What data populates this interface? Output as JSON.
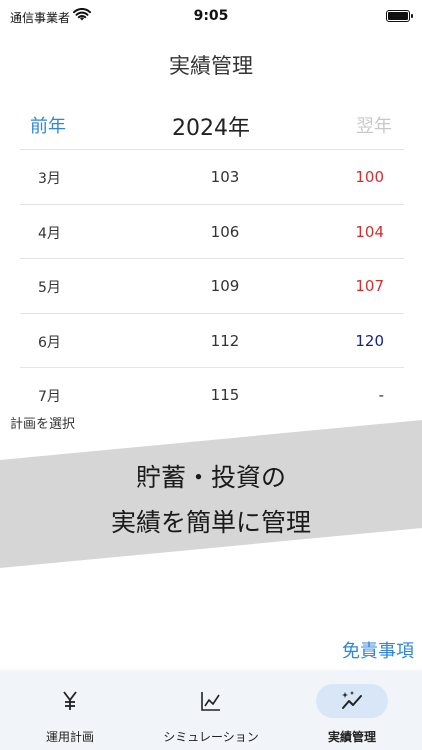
{
  "status_bar": {
    "carrier": "通信事業者",
    "time": "9:05"
  },
  "page": {
    "title": "実績管理"
  },
  "year_nav": {
    "prev": "前年",
    "current": "2024年",
    "next": "翌年"
  },
  "rows": [
    {
      "month": "3月",
      "actual": "103",
      "plan": "100",
      "plan_color": "#d32f2f"
    },
    {
      "month": "4月",
      "actual": "106",
      "plan": "104",
      "plan_color": "#d32f2f"
    },
    {
      "month": "5月",
      "actual": "109",
      "plan": "107",
      "plan_color": "#d32f2f"
    },
    {
      "month": "6月",
      "actual": "112",
      "plan": "120",
      "plan_color": "#1a237e"
    },
    {
      "month": "7月",
      "actual": "115",
      "plan": "-",
      "plan_color": "#333333"
    }
  ],
  "plan_select_label": "計画を選択",
  "banner": {
    "line1": "貯蓄・投資の",
    "line2": "実績を簡単に管理"
  },
  "disclaimer_link": "免責事項",
  "tabs": [
    {
      "label": "運用計画",
      "icon": "yen-icon",
      "active": false
    },
    {
      "label": "シミュレーション",
      "icon": "chart-icon",
      "active": false
    },
    {
      "label": "実績管理",
      "icon": "sparkle-chart-icon",
      "active": true
    }
  ],
  "colors": {
    "accent": "#2f86dc",
    "over_plan": "#d32f2f",
    "under_plan": "#1a237e",
    "tab_active_bg": "#d9e6f7",
    "banner_band": "#d6d6d6"
  }
}
